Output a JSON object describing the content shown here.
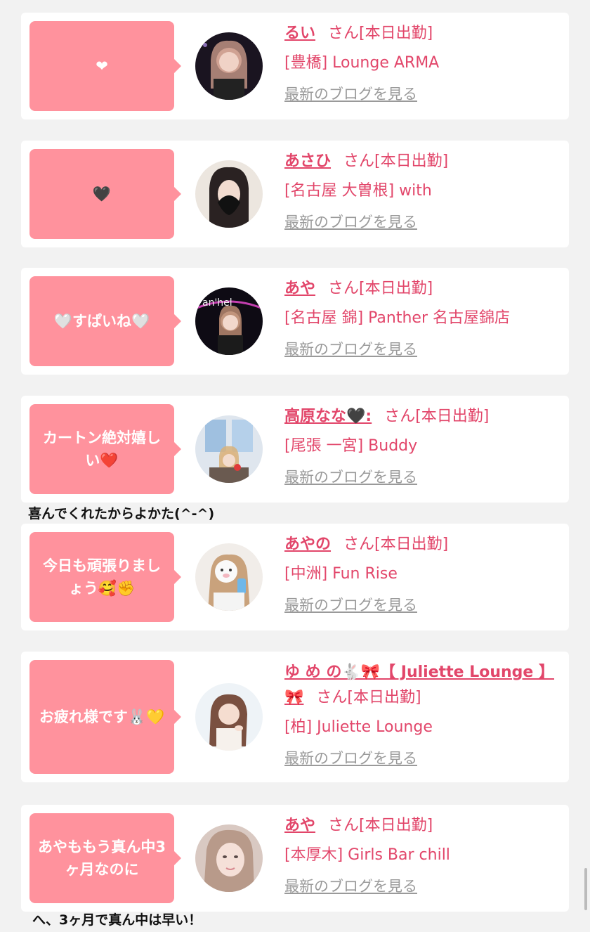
{
  "entries": [
    {
      "message": "❤",
      "name": "るい",
      "san": "さん",
      "status": "[本日出勤]",
      "shop": "[豊橋] Lounge ARMA",
      "blog": "最新のブログを見る"
    },
    {
      "message": "🖤",
      "name": "あさひ",
      "san": "さん",
      "status": "[本日出勤]",
      "shop": "[名古屋 大曽根] with",
      "blog": "最新のブログを見る"
    },
    {
      "message": "🤍すぱいね🤍",
      "name": "あや",
      "san": "さん",
      "status": "[本日出勤]",
      "shop": "[名古屋 錦] Panther 名古屋錦店",
      "blog": "最新のブログを見る"
    },
    {
      "message": "カートン絶対嬉しい❤️",
      "name": "高原なな🖤:",
      "san": "さん",
      "status": "[本日出勤]",
      "shop": "[尾張 一宮] Buddy",
      "blog": "最新のブログを見る"
    },
    {
      "message": "今日も頑張りましょう🥰✊",
      "name": "あやの",
      "san": "さん",
      "status": "[本日出勤]",
      "shop": "[中洲] Fun Rise",
      "blog": "最新のブログを見る"
    },
    {
      "message": "お疲れ様です🐰💛",
      "name": "ゆ め の🐇🎀【 Juliette Lounge 】🎀",
      "san": "さん",
      "status": "[本日出勤]",
      "shop": "[柏] Juliette Lounge",
      "blog": "最新のブログを見る"
    },
    {
      "message": "あやももう真ん中3ヶ月なのに",
      "name": "あや",
      "san": "さん",
      "status": "[本日出勤]",
      "shop": "[本厚木] Girls Bar chill",
      "blog": "最新のブログを見る"
    }
  ],
  "notes": {
    "note1": "喜んでくれたからよかた(^-^)",
    "note2": "へ、3ヶ月で真ん中は早い！"
  },
  "colors": {
    "bubble": "#ff929d",
    "accent": "#e2466a",
    "muted": "#9a9a9a"
  }
}
